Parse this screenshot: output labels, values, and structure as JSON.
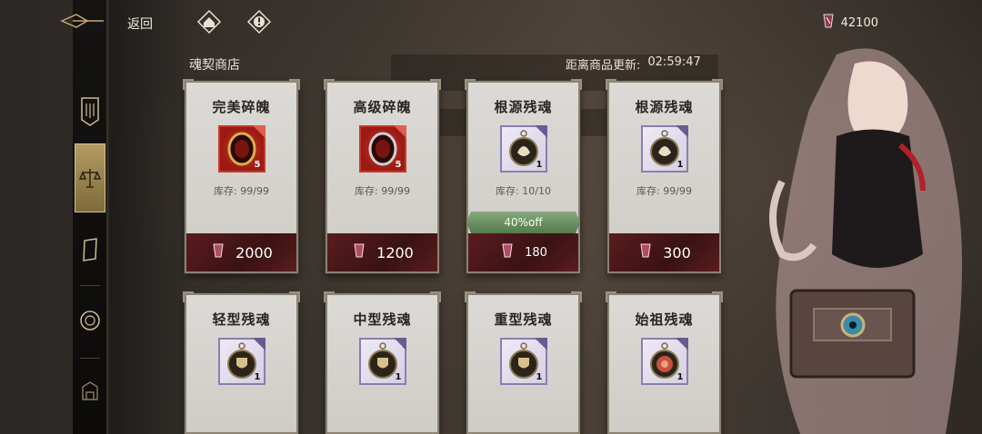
{
  "topbar": {
    "back_label": "返回",
    "currency_value": "42100"
  },
  "shop": {
    "title": "魂契商店",
    "refresh_label": "距离商品更新:",
    "refresh_time": "02:59:47"
  },
  "cards": [
    {
      "name": "完美碎魄",
      "frame": "red",
      "qty": "5",
      "stock_label": "库存:",
      "stock": "99/99",
      "price": "2000",
      "discount": ""
    },
    {
      "name": "高级碎魄",
      "frame": "red",
      "qty": "5",
      "stock_label": "库存:",
      "stock": "99/99",
      "price": "1200",
      "discount": ""
    },
    {
      "name": "根源残魂",
      "frame": "purple",
      "qty": "1",
      "stock_label": "库存:",
      "stock": "10/10",
      "price": "180",
      "discount": "40%off"
    },
    {
      "name": "根源残魂",
      "frame": "purple",
      "qty": "1",
      "stock_label": "库存:",
      "stock": "99/99",
      "price": "300",
      "discount": ""
    },
    {
      "name": "轻型残魂",
      "frame": "purple",
      "qty": "1"
    },
    {
      "name": "中型残魂",
      "frame": "purple",
      "qty": "1"
    },
    {
      "name": "重型残魂",
      "frame": "purple",
      "qty": "1"
    },
    {
      "name": "始祖残魂",
      "frame": "purple",
      "qty": "1"
    }
  ],
  "colors": {
    "price_bar": "#4a1618",
    "discount": "#6f9466",
    "accent_gold": "#b39b62"
  },
  "icons": [
    "back-ornament-icon",
    "home-icon",
    "alert-icon",
    "crystal-currency-icon",
    "banner-icon",
    "scales-icon",
    "card-icon",
    "medallion-icon"
  ]
}
